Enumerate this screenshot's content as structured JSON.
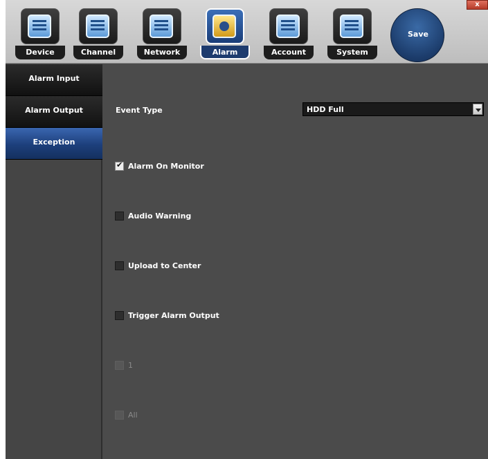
{
  "tabs": [
    {
      "label": "Device",
      "icon": "device-icon"
    },
    {
      "label": "Channel",
      "icon": "channel-icon"
    },
    {
      "label": "Network",
      "icon": "network-icon"
    },
    {
      "label": "Alarm",
      "icon": "alarm-icon",
      "active": true
    },
    {
      "label": "Account",
      "icon": "account-icon"
    },
    {
      "label": "System",
      "icon": "system-icon"
    }
  ],
  "save_label": "Save",
  "close_label": "x",
  "sidebar": {
    "items": [
      {
        "label": "Alarm Input"
      },
      {
        "label": "Alarm Output"
      },
      {
        "label": "Exception",
        "active": true
      }
    ]
  },
  "form": {
    "event_type_label": "Event Type",
    "event_type_value": "HDD Full",
    "options": [
      {
        "label": "Alarm On Monitor",
        "checked": true
      },
      {
        "label": "Audio Warning",
        "checked": false
      },
      {
        "label": "Upload to Center",
        "checked": false
      },
      {
        "label": "Trigger Alarm Output",
        "checked": false
      },
      {
        "label": "1",
        "checked": false,
        "disabled": true
      },
      {
        "label": "All",
        "checked": false,
        "disabled": true
      }
    ]
  },
  "colors": {
    "accent": "#1d3f7b",
    "panel": "#4b4b4b"
  }
}
